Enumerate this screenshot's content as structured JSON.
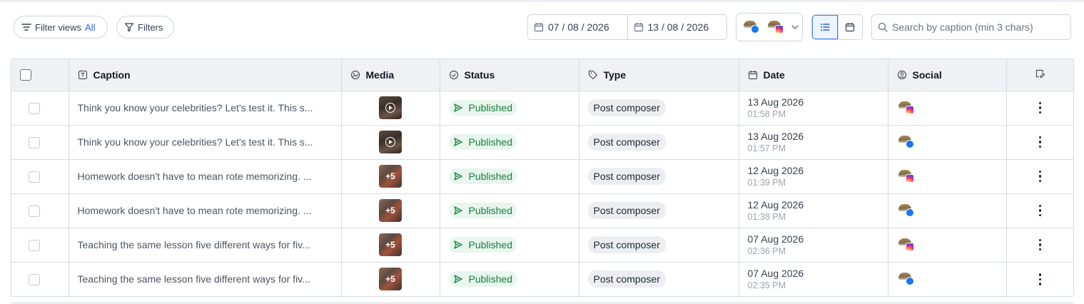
{
  "toolbar": {
    "filter_views_label": "Filter views",
    "filter_views_value": "All",
    "filters_label": "Filters",
    "date_from": "07 / 08 / 2026",
    "date_to": "13 / 08 / 2026",
    "search_placeholder": "Search by caption (min 3 chars)",
    "account_networks": [
      "facebook",
      "instagram"
    ],
    "active_view": "list"
  },
  "table": {
    "columns": [
      {
        "key": "select",
        "label": ""
      },
      {
        "key": "caption",
        "label": "Caption",
        "icon": "text-icon"
      },
      {
        "key": "media",
        "label": "Media",
        "icon": "image-icon"
      },
      {
        "key": "status",
        "label": "Status",
        "icon": "check-circle-icon"
      },
      {
        "key": "type",
        "label": "Type",
        "icon": "tag-icon"
      },
      {
        "key": "date",
        "label": "Date",
        "icon": "calendar-icon"
      },
      {
        "key": "social",
        "label": "Social",
        "icon": "user-circle-icon"
      },
      {
        "key": "actions",
        "label": "",
        "icon": "edit-columns-icon"
      }
    ],
    "rows": [
      {
        "caption": "Think you know your celebrities? Let's test it. This s...",
        "media": "video",
        "media_count": "",
        "status": "Published",
        "type": "Post composer",
        "date": "13 Aug 2026",
        "time": "01:58 PM",
        "network": "instagram"
      },
      {
        "caption": "Think you know your celebrities? Let's test it. This s...",
        "media": "video",
        "media_count": "",
        "status": "Published",
        "type": "Post composer",
        "date": "13 Aug 2026",
        "time": "01:57 PM",
        "network": "facebook"
      },
      {
        "caption": "Homework doesn't have to mean rote memorizing. ...",
        "media": "multi",
        "media_count": "+5",
        "status": "Published",
        "type": "Post composer",
        "date": "12 Aug 2026",
        "time": "01:39 PM",
        "network": "instagram"
      },
      {
        "caption": "Homework doesn't have to mean rote memorizing. ...",
        "media": "multi",
        "media_count": "+5",
        "status": "Published",
        "type": "Post composer",
        "date": "12 Aug 2026",
        "time": "01:38 PM",
        "network": "facebook"
      },
      {
        "caption": "Teaching the same lesson five different ways for fiv...",
        "media": "multi",
        "media_count": "+5",
        "status": "Published",
        "type": "Post composer",
        "date": "07 Aug 2026",
        "time": "02:36 PM",
        "network": "instagram"
      },
      {
        "caption": "Teaching the same lesson five different ways for fiv...",
        "media": "multi",
        "media_count": "+5",
        "status": "Published",
        "type": "Post composer",
        "date": "07 Aug 2026",
        "time": "02:35 PM",
        "network": "facebook"
      }
    ]
  },
  "colors": {
    "accent": "#2563eb",
    "published_text": "#16803c",
    "published_bg": "#e8f6ee",
    "header_bg": "#f0f1f4"
  }
}
